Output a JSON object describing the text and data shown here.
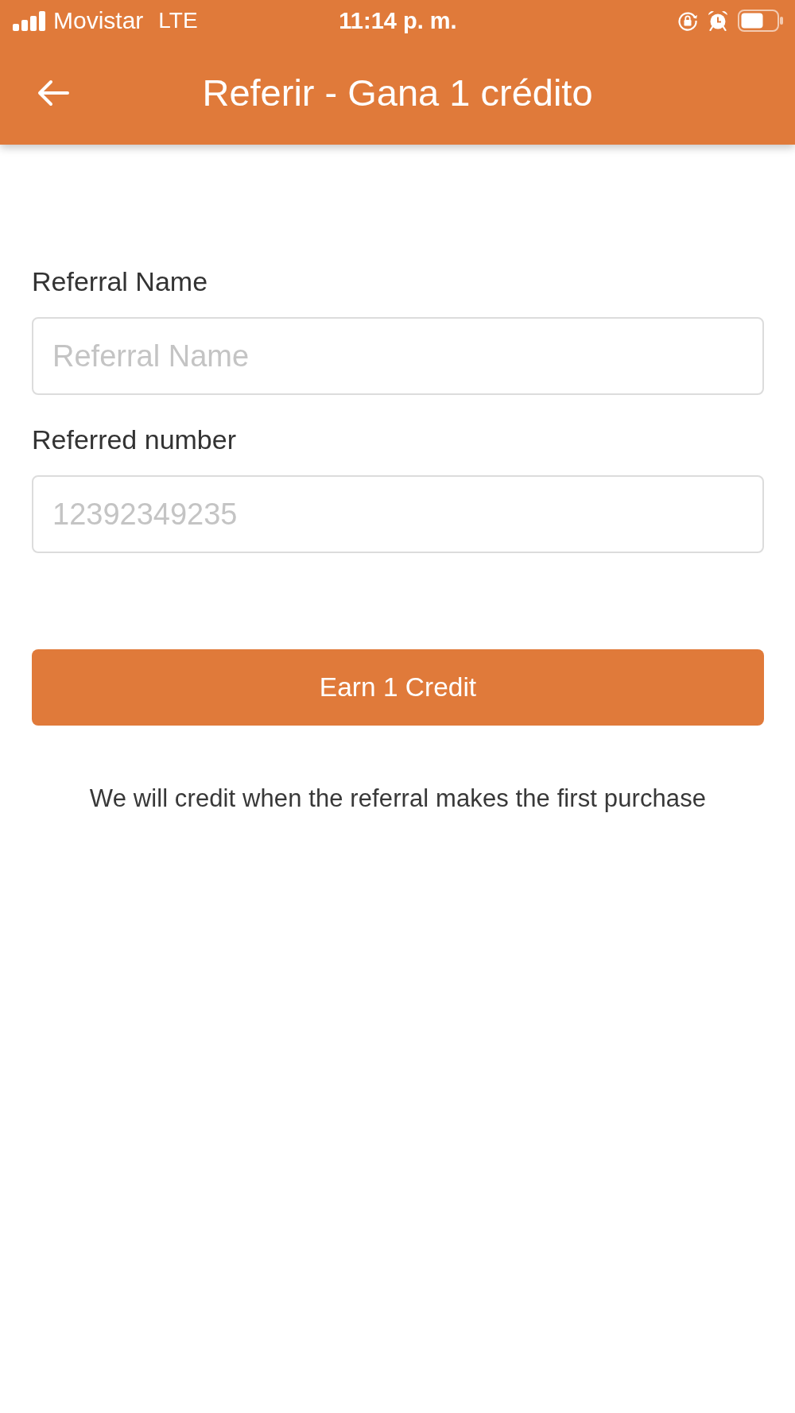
{
  "status_bar": {
    "carrier": "Movistar",
    "network": "LTE",
    "time": "11:14 p. m."
  },
  "header": {
    "title": "Referir - Gana 1 crédito"
  },
  "form": {
    "fields": [
      {
        "label": "Referral Name",
        "placeholder": "Referral Name"
      },
      {
        "label": "Referred number",
        "placeholder": "12392349235"
      }
    ],
    "submit_button": "Earn 1 Credit",
    "note": "We will credit when the referral makes the first purchase"
  }
}
